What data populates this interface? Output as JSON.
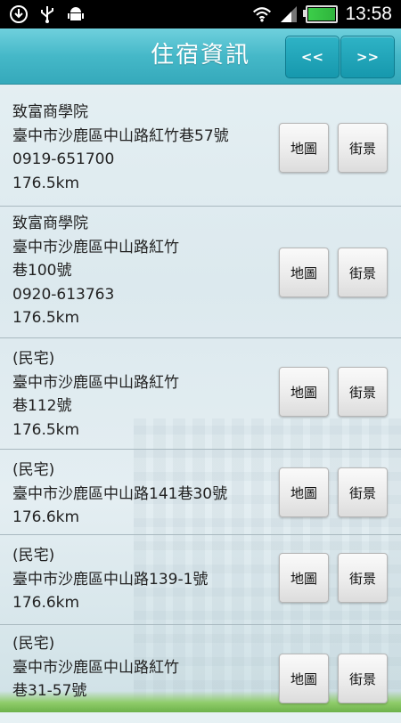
{
  "status_bar": {
    "time": "13:58",
    "icons": [
      "download-icon",
      "usb-icon",
      "android-debug-icon",
      "wifi-icon",
      "signal-icon",
      "battery-icon"
    ]
  },
  "header": {
    "title": "住宿資訊",
    "prev_label": "<<",
    "next_label": ">>",
    "color": "#45b8c8"
  },
  "list": {
    "map_label": "地圖",
    "street_label": "街景",
    "items": [
      {
        "name": "致富商學院",
        "address_lines": [
          "臺中市沙鹿區中山路紅竹巷57號"
        ],
        "phone": "0919-651700",
        "distance": "176.5km"
      },
      {
        "name": "致富商學院",
        "address_lines": [
          "臺中市沙鹿區中山路紅竹",
          "巷100號"
        ],
        "phone": "0920-613763",
        "distance": "176.5km"
      },
      {
        "name": "(民宅)",
        "address_lines": [
          "臺中市沙鹿區中山路紅竹",
          "巷112號"
        ],
        "phone": "",
        "distance": "176.5km"
      },
      {
        "name": "(民宅)",
        "address_lines": [
          "臺中市沙鹿區中山路141巷30號"
        ],
        "phone": "",
        "distance": "176.6km"
      },
      {
        "name": "(民宅)",
        "address_lines": [
          "臺中市沙鹿區中山路139-1號"
        ],
        "phone": "",
        "distance": "176.6km"
      },
      {
        "name": "(民宅)",
        "address_lines": [
          "臺中市沙鹿區中山路紅竹",
          "巷31-57號"
        ],
        "phone": "",
        "distance": ""
      }
    ]
  }
}
